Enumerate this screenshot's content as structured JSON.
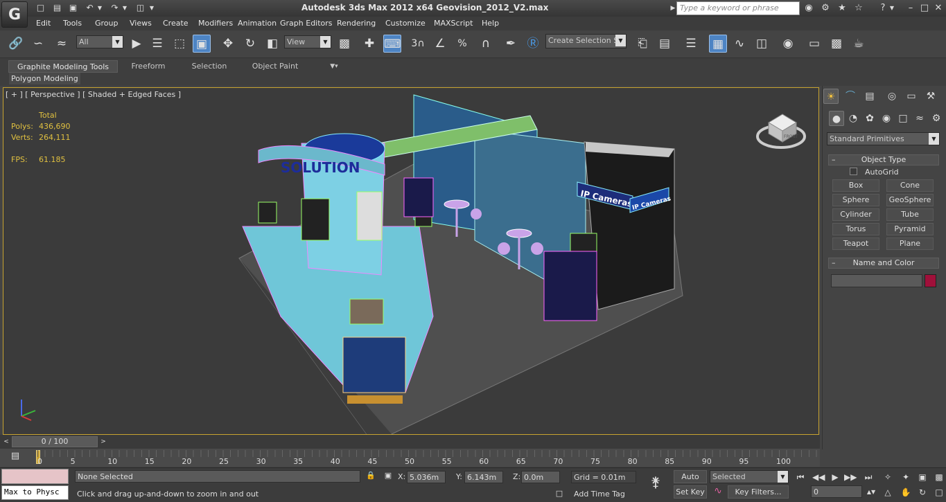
{
  "app": {
    "title": "Autodesk 3ds Max  2012 x64     Geovision_2012_V2.max",
    "logo": "G"
  },
  "search": {
    "placeholder": "Type a keyword or phrase"
  },
  "menu": [
    "Edit",
    "Tools",
    "Group",
    "Views",
    "Create",
    "Modifiers",
    "Animation",
    "Graph Editors",
    "Rendering",
    "Customize",
    "MAXScript",
    "Help"
  ],
  "toolbar": {
    "selection_filter": "All",
    "reference_coord": "View",
    "named_selection": "Create Selection Se",
    "snap_labels": {
      "snap": "3",
      "angle": "∠",
      "percent": "%"
    }
  },
  "ribbon": {
    "tabs": [
      "Graphite Modeling Tools",
      "Freeform",
      "Selection",
      "Object Paint"
    ],
    "panel": "Polygon Modeling"
  },
  "viewport": {
    "label": "[ + ] [ Perspective ] [ Shaded + Edged Faces ]",
    "stats": {
      "header": "Total",
      "polys_label": "Polys:",
      "polys": "436,690",
      "verts_label": "Verts:",
      "verts": "264,111",
      "fps_label": "FPS:",
      "fps": "61.185"
    },
    "scene_text": {
      "solution": "SOLUTION",
      "ip_cameras": "IP Cameras",
      "ip_cameras_2": "IP Cameras"
    },
    "viewcube_label": "FRONT"
  },
  "command_panel": {
    "category": "Standard Primitives",
    "object_type_title": "Object Type",
    "autogrid": "AutoGrid",
    "buttons": [
      "Box",
      "Cone",
      "Sphere",
      "GeoSphere",
      "Cylinder",
      "Tube",
      "Torus",
      "Pyramid",
      "Teapot",
      "Plane"
    ],
    "name_color_title": "Name and Color",
    "name_value": "",
    "color": "#a0103a"
  },
  "timeline": {
    "frame_display": "0 / 100",
    "ticks": [
      "0",
      "5",
      "10",
      "15",
      "20",
      "25",
      "30",
      "35",
      "40",
      "45",
      "50",
      "55",
      "60",
      "65",
      "70",
      "75",
      "80",
      "85",
      "90",
      "95",
      "100"
    ]
  },
  "status": {
    "maxscript": "Max to Physc",
    "selection": "None Selected",
    "prompt": "Click and drag up-and-down to zoom in and out",
    "x_label": "X:",
    "x": "5.036m",
    "y_label": "Y:",
    "y": "6.143m",
    "z_label": "Z:",
    "z": "0.0m",
    "grid": "Grid = 0.01m",
    "add_time_tag": "Add Time Tag",
    "auto_key": "Auto Key",
    "set_key": "Set Key",
    "key_mode": "Selected",
    "key_filters": "Key Filters...",
    "current_frame": "0"
  }
}
